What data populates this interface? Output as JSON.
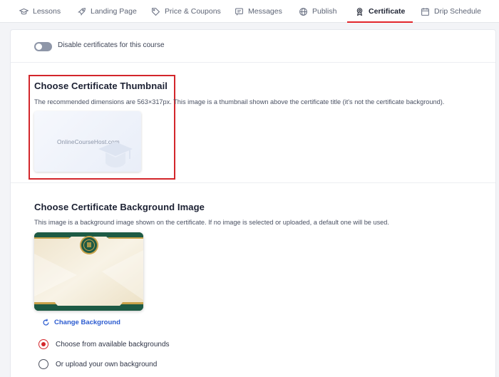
{
  "tabs": [
    {
      "label": "Lessons",
      "icon": "graduation-cap-icon"
    },
    {
      "label": "Landing Page",
      "icon": "rocket-icon"
    },
    {
      "label": "Price & Coupons",
      "icon": "tag-icon"
    },
    {
      "label": "Messages",
      "icon": "message-icon"
    },
    {
      "label": "Publish",
      "icon": "globe-icon"
    },
    {
      "label": "Certificate",
      "icon": "award-icon",
      "active": true
    },
    {
      "label": "Drip Schedule",
      "icon": "calendar-icon"
    }
  ],
  "toggle": {
    "label": "Disable certificates for this course",
    "enabled": false
  },
  "thumbnail": {
    "title": "Choose Certificate Thumbnail",
    "description": "The recommended dimensions are 563×317px. This image is a thumbnail shown above the certificate title (it's not the certificate background).",
    "brand_text": "OnlineCourseHost.com"
  },
  "background": {
    "title": "Choose Certificate Background Image",
    "description": "This image is a background image shown on the certificate. If no image is selected or uploaded, a default one will be used.",
    "change_label": "Change Background",
    "options": [
      {
        "label": "Choose from available backgrounds",
        "checked": true
      },
      {
        "label": "Or upload your own background",
        "checked": false
      }
    ]
  },
  "colors": {
    "accent": "#d3262b",
    "link": "#2b5bd0",
    "frame_green": "#1d5a44",
    "frame_gold": "#c9a24a"
  }
}
